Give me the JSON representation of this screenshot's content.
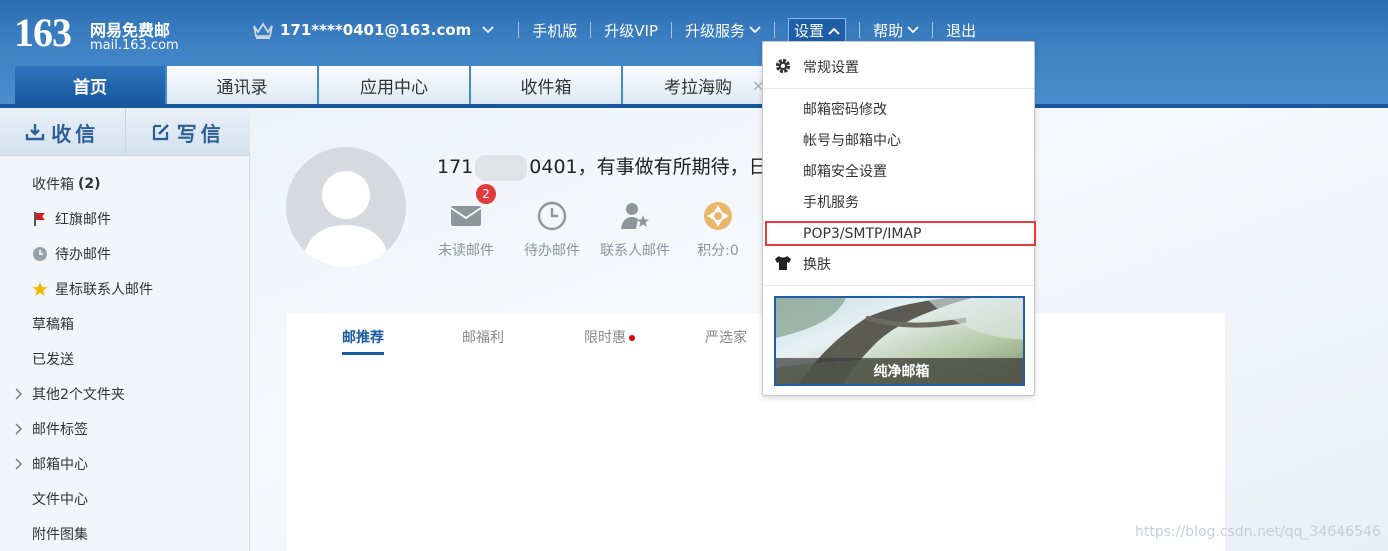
{
  "logo": {
    "number": "163",
    "name": "网易免费邮",
    "url": "mail.163.com"
  },
  "topnav": {
    "account": "171****0401@163.com",
    "mobile": "手机版",
    "vip": "升级VIP",
    "upgrade_service": "升级服务",
    "settings": "设置",
    "help": "帮助",
    "logout": "退出"
  },
  "tabs": [
    {
      "label": "首页"
    },
    {
      "label": "通讯录"
    },
    {
      "label": "应用中心"
    },
    {
      "label": "收件箱"
    },
    {
      "label": "考拉海购",
      "close": "×"
    }
  ],
  "sidebar": {
    "receive": "收信",
    "compose": "写信",
    "folders": [
      {
        "label": "收件箱",
        "count": "(2)"
      },
      {
        "label": "红旗邮件",
        "icon": "red-flag-icon"
      },
      {
        "label": "待办邮件",
        "icon": "clock-icon"
      },
      {
        "label": "星标联系人邮件",
        "icon": "star-icon"
      },
      {
        "label": "草稿箱"
      },
      {
        "label": "已发送"
      },
      {
        "label": "其他2个文件夹",
        "expand": true
      },
      {
        "label": "邮件标签",
        "expand": true
      },
      {
        "label": "邮箱中心",
        "expand": true
      },
      {
        "label": "文件中心"
      },
      {
        "label": "附件图集"
      }
    ]
  },
  "main": {
    "greeting_prefix": "171",
    "greeting_suffix": "0401，有事做有所期待，日",
    "stats": [
      {
        "label": "未读邮件",
        "badge": "2"
      },
      {
        "label": "待办邮件"
      },
      {
        "label": "联系人邮件"
      },
      {
        "label": "积分:0"
      }
    ],
    "panel_tabs": [
      {
        "label": "邮推荐",
        "active": true
      },
      {
        "label": "邮福利"
      },
      {
        "label": "限时惠",
        "dot": true
      },
      {
        "label": "严选家"
      }
    ]
  },
  "settings_menu": {
    "general": "常规设置",
    "items": [
      "邮箱密码修改",
      "帐号与邮箱中心",
      "邮箱安全设置",
      "手机服务",
      "POP3/SMTP/IMAP"
    ],
    "skin": "换肤",
    "skin_preview": "纯净邮箱",
    "highlighted_item": "POP3/SMTP/IMAP"
  },
  "watermark": "https://blog.csdn.net/qq_34646546",
  "colors": {
    "header": "#2b6db1",
    "tab_active": "#17589e",
    "accent": "#1a5a9e",
    "badge": "#e23b3b",
    "highlight_border": "#e53b3b"
  }
}
